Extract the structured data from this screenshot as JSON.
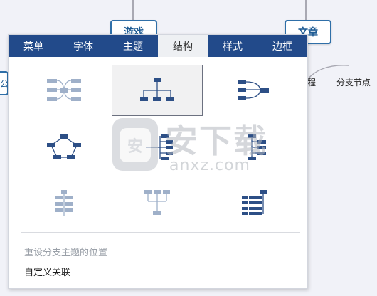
{
  "canvas": {
    "nodes": {
      "game": "游戏",
      "article": "文章"
    },
    "left_partial_label": "公",
    "right_labels": {
      "process": "程",
      "branch_node": "分支节点"
    }
  },
  "tabs": [
    {
      "label": "菜单",
      "active": false
    },
    {
      "label": "字体",
      "active": false
    },
    {
      "label": "主题",
      "active": false
    },
    {
      "label": "结构",
      "active": true
    },
    {
      "label": "样式",
      "active": false
    },
    {
      "label": "边框",
      "active": false
    }
  ],
  "structures": [
    {
      "icon": "mind-map-structure-icon",
      "selected": false
    },
    {
      "icon": "org-chart-structure-icon",
      "selected": true
    },
    {
      "icon": "logic-right-structure-icon",
      "selected": false
    },
    {
      "icon": "circular-structure-icon",
      "selected": false
    },
    {
      "icon": "tree-left-structure-icon",
      "selected": false
    },
    {
      "icon": "tree-right-structure-icon",
      "selected": false
    },
    {
      "icon": "timeline-vertical-structure-icon",
      "selected": false
    },
    {
      "icon": "tree-down-structure-icon",
      "selected": false
    },
    {
      "icon": "bracket-list-structure-icon",
      "selected": false
    }
  ],
  "menu": {
    "reset_branch": "重设分支主题的位置",
    "custom_relation": "自定义关联"
  },
  "watermark": {
    "cn": "安下载",
    "en": "anxz.com",
    "logo_char": "安"
  },
  "colors": {
    "tab_bar": "#224a8a",
    "node_border": "#2f6fa8",
    "icon_dark": "#2d4f86",
    "icon_light": "#9fb0c9"
  }
}
